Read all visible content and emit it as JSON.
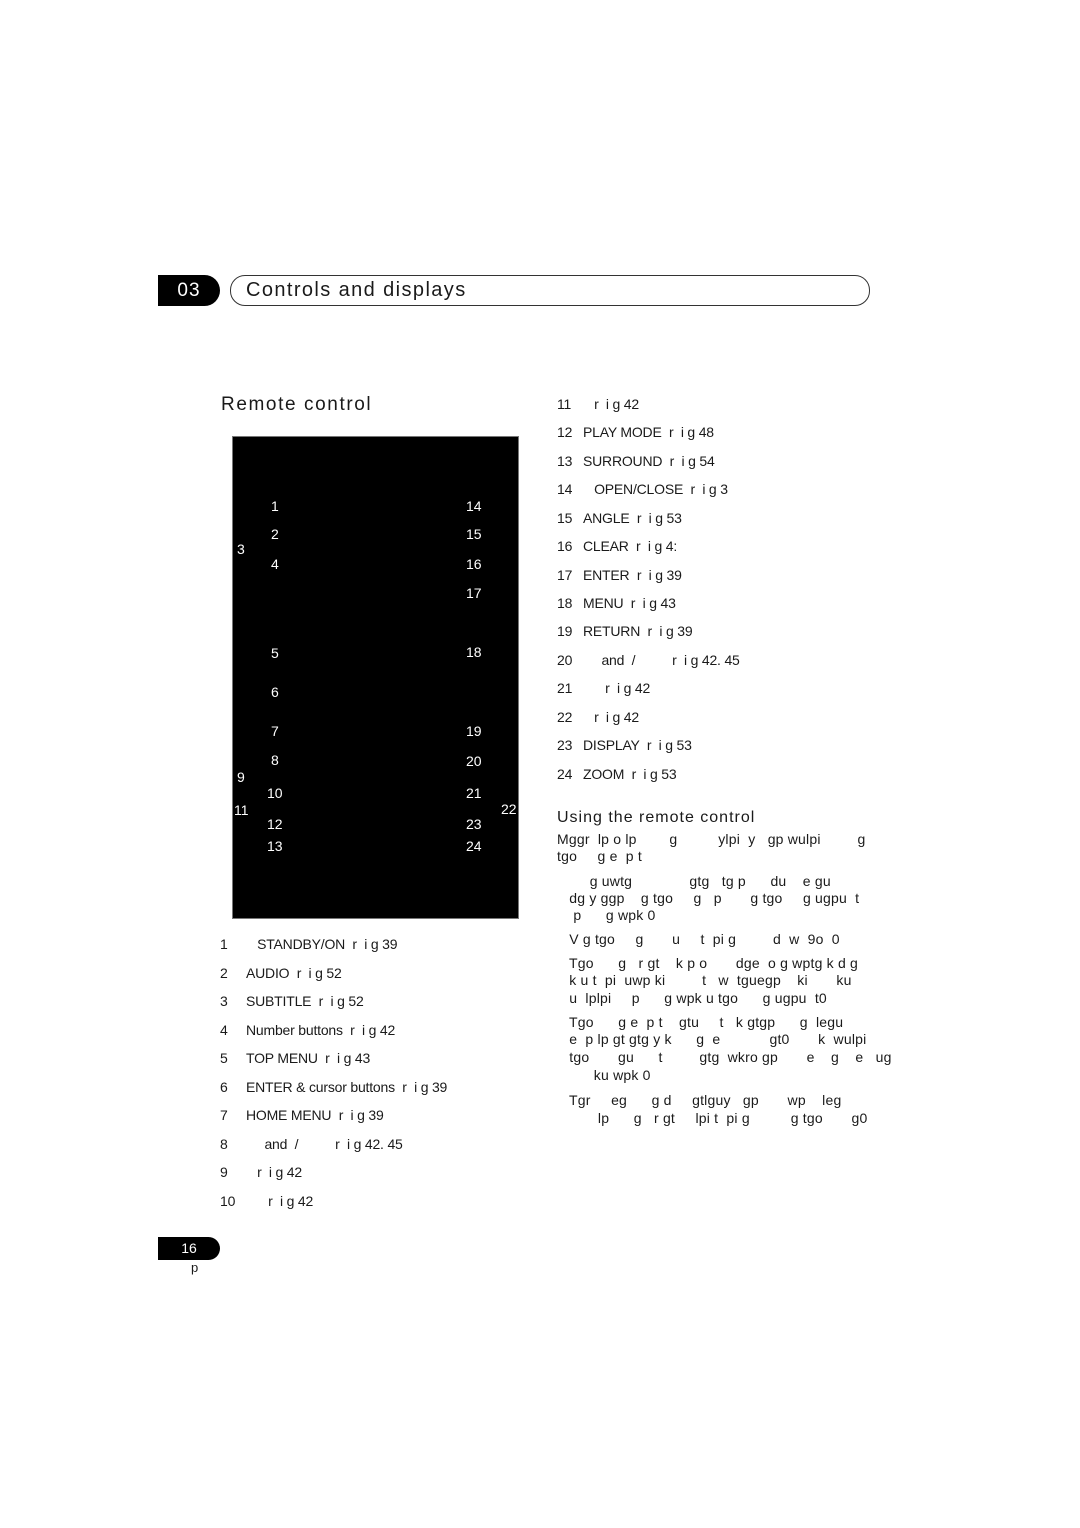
{
  "header": {
    "chapter_number": "03",
    "chapter_title": "Controls and displays"
  },
  "section": {
    "title": "Remote control"
  },
  "remote_callouts": [
    "1",
    "2",
    "3",
    "4",
    "5",
    "6",
    "7",
    "8",
    "9",
    "10",
    "11",
    "12",
    "13",
    "14",
    "15",
    "16",
    "17",
    "18",
    "19",
    "20",
    "21",
    "22",
    "23",
    "24"
  ],
  "left_list": [
    {
      "num": "1",
      "text": "   STANDBY/ON  r  i g 39"
    },
    {
      "num": "2",
      "text": "AUDIO  r  i g 52"
    },
    {
      "num": "3",
      "text": "SUBTITLE  r  i g 52"
    },
    {
      "num": "4",
      "text": "Number buttons  r  i g 42"
    },
    {
      "num": "5",
      "text": "TOP MENU  r  i g 43"
    },
    {
      "num": "6",
      "text": "ENTER & cursor buttons  r  i g 39"
    },
    {
      "num": "7",
      "text": "HOME MENU  r  i g 39"
    },
    {
      "num": "8",
      "text": "     and  /          r  i g 42. 45"
    },
    {
      "num": "9",
      "text": "   r  i g 42"
    },
    {
      "num": "10",
      "text": "      r  i g 42"
    }
  ],
  "right_list": [
    {
      "num": "11",
      "text": "   r  i g 42"
    },
    {
      "num": "12",
      "text": "PLAY MODE  r  i g 48"
    },
    {
      "num": "13",
      "text": "SURROUND  r  i g 54"
    },
    {
      "num": "14",
      "text": "   OPEN/CLOSE  r  i g 3"
    },
    {
      "num": "15",
      "text": "ANGLE  r  i g 53"
    },
    {
      "num": "16",
      "text": "CLEAR  r  i g 4:"
    },
    {
      "num": "17",
      "text": "ENTER  r  i g 39"
    },
    {
      "num": "18",
      "text": "MENU  r  i g 43"
    },
    {
      "num": "19",
      "text": "RETURN  r  i g 39"
    },
    {
      "num": "20",
      "text": "     and  /          r  i g 42. 45"
    },
    {
      "num": "21",
      "text": "      r  i g 42"
    },
    {
      "num": "22",
      "text": "   r  i g 42"
    },
    {
      "num": "23",
      "text": "DISPLAY  r  i g 53"
    },
    {
      "num": "24",
      "text": "ZOOM  r  i g 53"
    }
  ],
  "using_section": {
    "title": "Using the remote control",
    "intro_lines": [
      "Mggr  lp o lp        g          ylpi  y   gp wulpi         g",
      "tgo     g e  p t"
    ],
    "bullets": [
      [
        "        g uwtg              gtg   tg p      du    e gu",
        "   dg y ggp    g tgo     g   p       g tgo     g ugpu  t",
        "    p      g wpk 0"
      ],
      [
        "   V g tgo     g       u     t  pi g         d  w  9o  0"
      ],
      [
        "   Tgo      g   r gt    k p o       dge  o g wptg k d g",
        "   k u t  pi  uwp ki         t   w  tguegp    ki       ku",
        "   u  lplpi     p      g wpk u tgo      g ugpu  t0"
      ],
      [
        "   Tgo      g e  p t    gtu     t   k gtgp      g  legu",
        "   e  p lp gt gtg y k      g  e            gt0       k  wulpi",
        "   tgo       gu      t         gtg  wkro gp       e    g    e   ug",
        "         ku wpk 0"
      ],
      [
        "   Tgr     eg      g d     gtlguy   gp       wp    leg",
        "          lp      g   r gt     lpi t  pi g          g tgo       g0"
      ]
    ]
  },
  "footer": {
    "page_number": "16",
    "language": "p"
  }
}
